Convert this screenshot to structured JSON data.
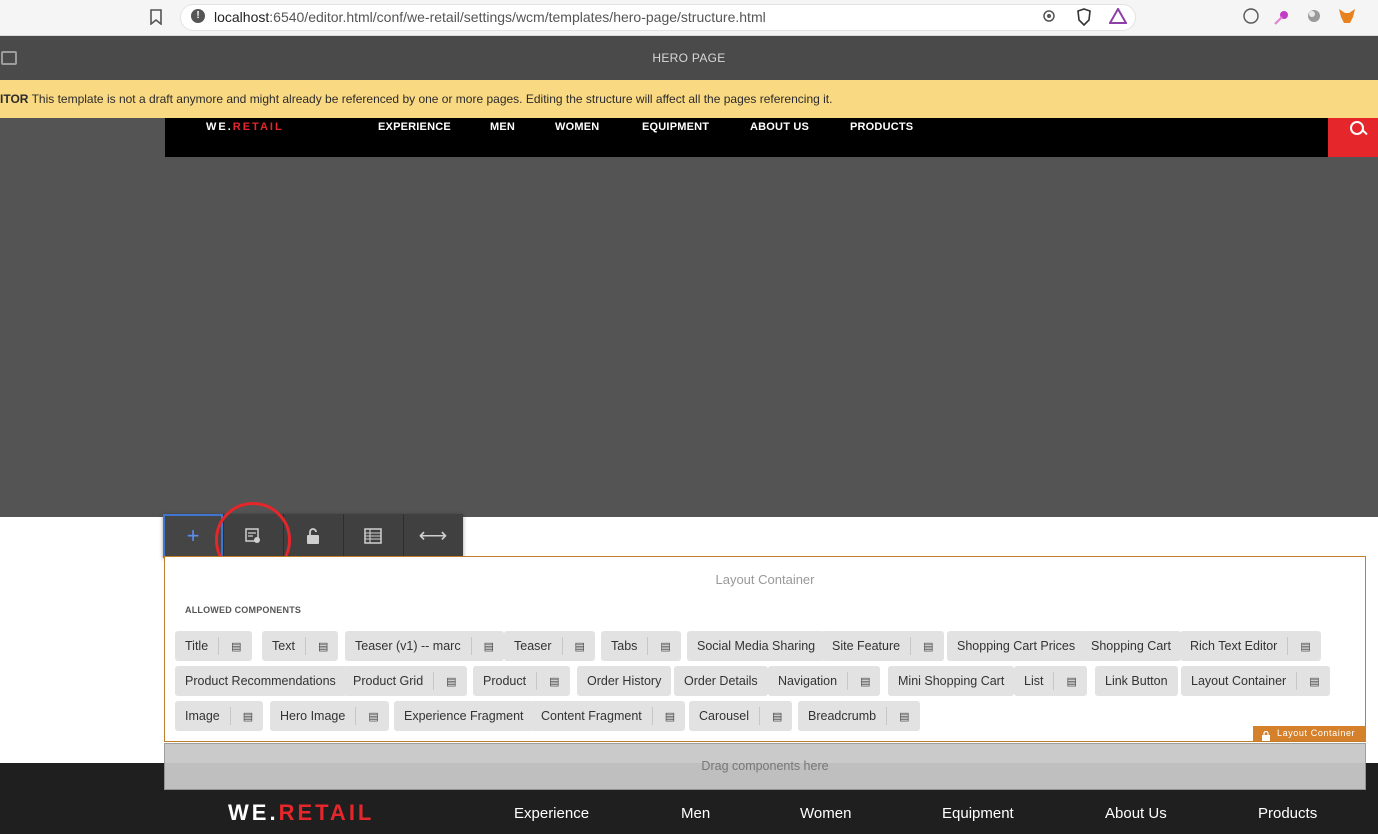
{
  "browser": {
    "url_host": "localhost",
    "url_rest": ":6540/editor.html/conf/we-retail/settings/wcm/templates/hero-page/structure.html"
  },
  "editor": {
    "page_title": "HERO PAGE",
    "warning_prefix": "ITOR",
    "warning_message": "This template is not a draft anymore and might already be referenced by one or more pages. Editing the structure will affect all the pages referencing it."
  },
  "top_nav": {
    "logo_main": "WE.",
    "logo_accent": "RETAIL",
    "items": [
      "EXPERIENCE",
      "MEN",
      "WOMEN",
      "EQUIPMENT",
      "ABOUT US",
      "PRODUCTS"
    ]
  },
  "toolbar": {
    "add_symbol": "+",
    "resize_symbol": "⟷"
  },
  "layout_container": {
    "title": "Layout Container",
    "allowed_label": "ALLOWED COMPONENTS",
    "badge": "Layout Container",
    "rows": [
      [
        {
          "label": "Title",
          "policy": true
        },
        {
          "label": "Text",
          "policy": true
        },
        {
          "label": "Teaser (v1) -- marc",
          "policy": true
        },
        {
          "label": "Teaser",
          "policy": true
        },
        {
          "label": "Tabs",
          "policy": true
        },
        {
          "label": "Social Media Sharing",
          "policy": false
        },
        {
          "label": "Site Feature",
          "policy": true
        },
        {
          "label": "Shopping Cart Prices",
          "policy": false
        },
        {
          "label": "Shopping Cart",
          "policy": false
        },
        {
          "label": "Rich Text Editor",
          "policy": true
        }
      ],
      [
        {
          "label": "Product Recommendations",
          "policy": false
        },
        {
          "label": "Product Grid",
          "policy": true
        },
        {
          "label": "Product",
          "policy": true
        },
        {
          "label": "Order History",
          "policy": false
        },
        {
          "label": "Order Details",
          "policy": false
        },
        {
          "label": "Navigation",
          "policy": true
        },
        {
          "label": "Mini Shopping Cart",
          "policy": false
        },
        {
          "label": "List",
          "policy": true
        },
        {
          "label": "Link Button",
          "policy": false
        },
        {
          "label": "Layout Container",
          "policy": true
        }
      ],
      [
        {
          "label": "Image",
          "policy": true
        },
        {
          "label": "Hero Image",
          "policy": true
        },
        {
          "label": "Experience Fragment",
          "policy": false
        },
        {
          "label": "Content Fragment",
          "policy": true
        },
        {
          "label": "Carousel",
          "policy": true
        },
        {
          "label": "Breadcrumb",
          "policy": true
        }
      ]
    ],
    "drag_text": "Drag components here"
  },
  "footer": {
    "logo_main": "WE.",
    "logo_accent": "RETAIL",
    "items": [
      "Experience",
      "Men",
      "Women",
      "Equipment",
      "About Us",
      "Products"
    ]
  }
}
